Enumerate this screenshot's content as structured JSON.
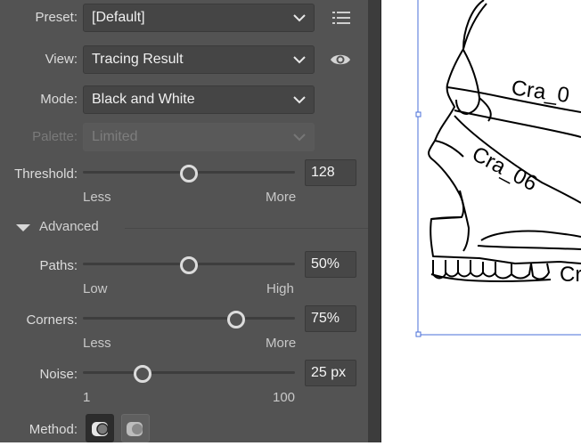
{
  "preset": {
    "label": "Preset:",
    "value": "[Default]"
  },
  "view": {
    "label": "View:",
    "value": "Tracing Result"
  },
  "mode": {
    "label": "Mode:",
    "value": "Black and White"
  },
  "palette": {
    "label": "Palette:",
    "value": "Limited"
  },
  "threshold": {
    "label": "Threshold:",
    "value": "128",
    "min_label": "Less",
    "max_label": "More",
    "level": 0.5
  },
  "advanced": {
    "label": "Advanced"
  },
  "paths": {
    "label": "Paths:",
    "value": "50%",
    "min_label": "Low",
    "max_label": "High",
    "level": 0.5
  },
  "corners": {
    "label": "Corners:",
    "value": "75%",
    "min_label": "Less",
    "max_label": "More",
    "level": 0.75
  },
  "noise": {
    "label": "Noise:",
    "value": "25 px",
    "min_label": "1",
    "max_label": "100",
    "level": 0.25
  },
  "method": {
    "label": "Method:"
  },
  "canvas": {
    "label_1": "Cra_0",
    "label_2": "Cra_06",
    "label_3": "Cr"
  }
}
